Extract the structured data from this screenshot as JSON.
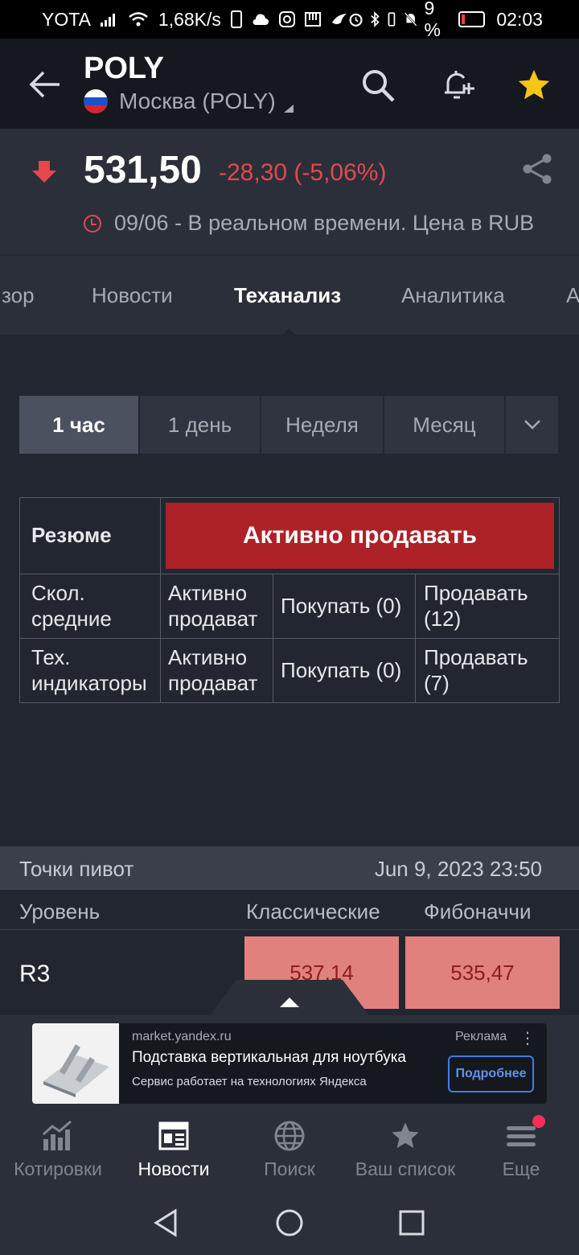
{
  "status_bar": {
    "carrier": "YOTA",
    "speed": "1,68K/s",
    "battery_pct": "9 %",
    "time": "02:03"
  },
  "header": {
    "title": "POLY",
    "exchange": "Москва (POLY)",
    "icons": [
      "back-arrow-icon",
      "search-icon",
      "add-alert-icon",
      "star-icon"
    ],
    "star_color": "#f5c518"
  },
  "quote": {
    "price": "531,50",
    "change": "-28,30 (-5,06%)",
    "realtime_info": "09/06 - В реальном времени. Цена в RUB",
    "change_color": "#e5484d"
  },
  "tabs": {
    "items": [
      "зор",
      "Новости",
      "Теханализ",
      "Аналитика",
      "А"
    ],
    "active": "Теханализ"
  },
  "periods": {
    "items": [
      "1 час",
      "1 день",
      "Неделя",
      "Месяц"
    ],
    "active": "1 час"
  },
  "summary": {
    "label": "Резюме",
    "verdict": "Активно продавать",
    "verdict_color": "#ac2227",
    "rows": [
      {
        "name": "Скол. средние",
        "signal": "Активно продават",
        "buy": "Покупать (0)",
        "sell": "Продавать (12)"
      },
      {
        "name": "Тех. индикаторы",
        "signal": "Активно продават",
        "buy": "Покупать (0)",
        "sell": "Продавать (7)"
      }
    ]
  },
  "pivot": {
    "title": "Точки пивот",
    "datetime": "Jun 9, 2023 23:50",
    "col_level": "Уровень",
    "col_classic": "Классические",
    "col_fib": "Фибоначчи",
    "rows": [
      {
        "level": "R3",
        "classic": "537,14",
        "fib": "535,47"
      }
    ]
  },
  "ad": {
    "domain": "market.yandex.ru",
    "label": "Реклама",
    "title": "Подставка вертикальная для ноутбука",
    "subtitle": "Сервис работает на технологиях Яндекса",
    "button": "Подробнее"
  },
  "bottom_nav": {
    "items": [
      {
        "label": "Котировки",
        "icon": "quotes-chart-icon"
      },
      {
        "label": "Новости",
        "icon": "news-icon"
      },
      {
        "label": "Поиск",
        "icon": "globe-icon"
      },
      {
        "label": "Ваш список",
        "icon": "star-icon"
      },
      {
        "label": "Еще",
        "icon": "menu-icon"
      }
    ],
    "active": "Новости"
  }
}
